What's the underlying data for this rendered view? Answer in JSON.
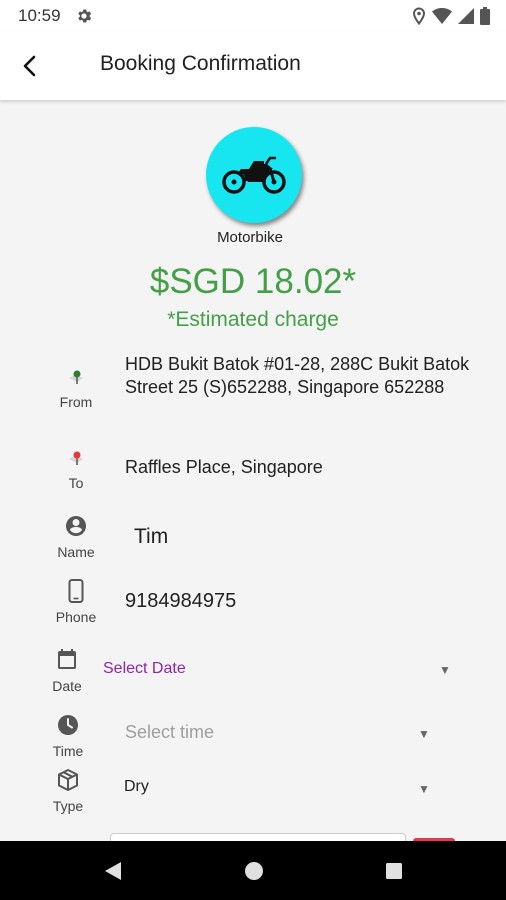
{
  "status_bar": {
    "time": "10:59"
  },
  "header": {
    "title": "Booking Confirmation"
  },
  "vehicle": {
    "label": "Motorbike"
  },
  "price": {
    "amount": "$SGD 18.02*",
    "note": "*Estimated charge"
  },
  "from": {
    "label": "From",
    "value": "HDB Bukit Batok #01-28, 288C Bukit Batok Street 25 (S)652288, Singapore 652288"
  },
  "to": {
    "label": "To",
    "value": "Raffles Place, Singapore"
  },
  "name": {
    "label": "Name",
    "value": "Tim"
  },
  "phone": {
    "label": "Phone",
    "value": "9184984975"
  },
  "date": {
    "label": "Date",
    "placeholder": "Select Date"
  },
  "time": {
    "label": "Time",
    "placeholder": "Select time"
  },
  "type": {
    "label": "Type",
    "value": "Dry"
  },
  "colors": {
    "accent_green": "#43a047",
    "vehicle_bg": "#17e6f0",
    "date_purple": "#8e24aa",
    "pin_green": "#2e7d32",
    "pin_red": "#e53935"
  },
  "icons": [
    "settings-gear-icon",
    "location-icon",
    "wifi-icon",
    "signal-icon",
    "battery-icon",
    "back-arrow-icon",
    "motorbike-icon",
    "map-pin-green-icon",
    "map-pin-red-icon",
    "account-circle-icon",
    "phone-icon",
    "calendar-icon",
    "clock-icon",
    "package-box-icon",
    "nav-back-icon",
    "nav-home-icon",
    "nav-recents-icon"
  ]
}
